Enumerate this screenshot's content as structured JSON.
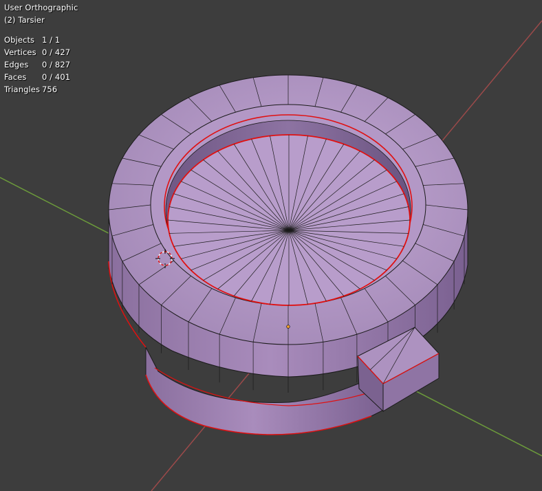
{
  "viewport": {
    "view_name": "User Orthographic",
    "object_label": "(2) Tarsier",
    "stats": [
      {
        "label": "Objects",
        "value": "1 / 1"
      },
      {
        "label": "Vertices",
        "value": "0 / 427"
      },
      {
        "label": "Edges",
        "value": "0 / 827"
      },
      {
        "label": "Faces",
        "value": "0 / 401"
      },
      {
        "label": "Triangles",
        "value": "756"
      }
    ]
  },
  "colors": {
    "background": "#3d3d3d",
    "x_axis": "#9c4a4a",
    "y_axis": "#6c9b3b",
    "mesh_face": "#a98cba",
    "mesh_edge": "#1a1a1a",
    "seam_edge": "#e01010"
  }
}
